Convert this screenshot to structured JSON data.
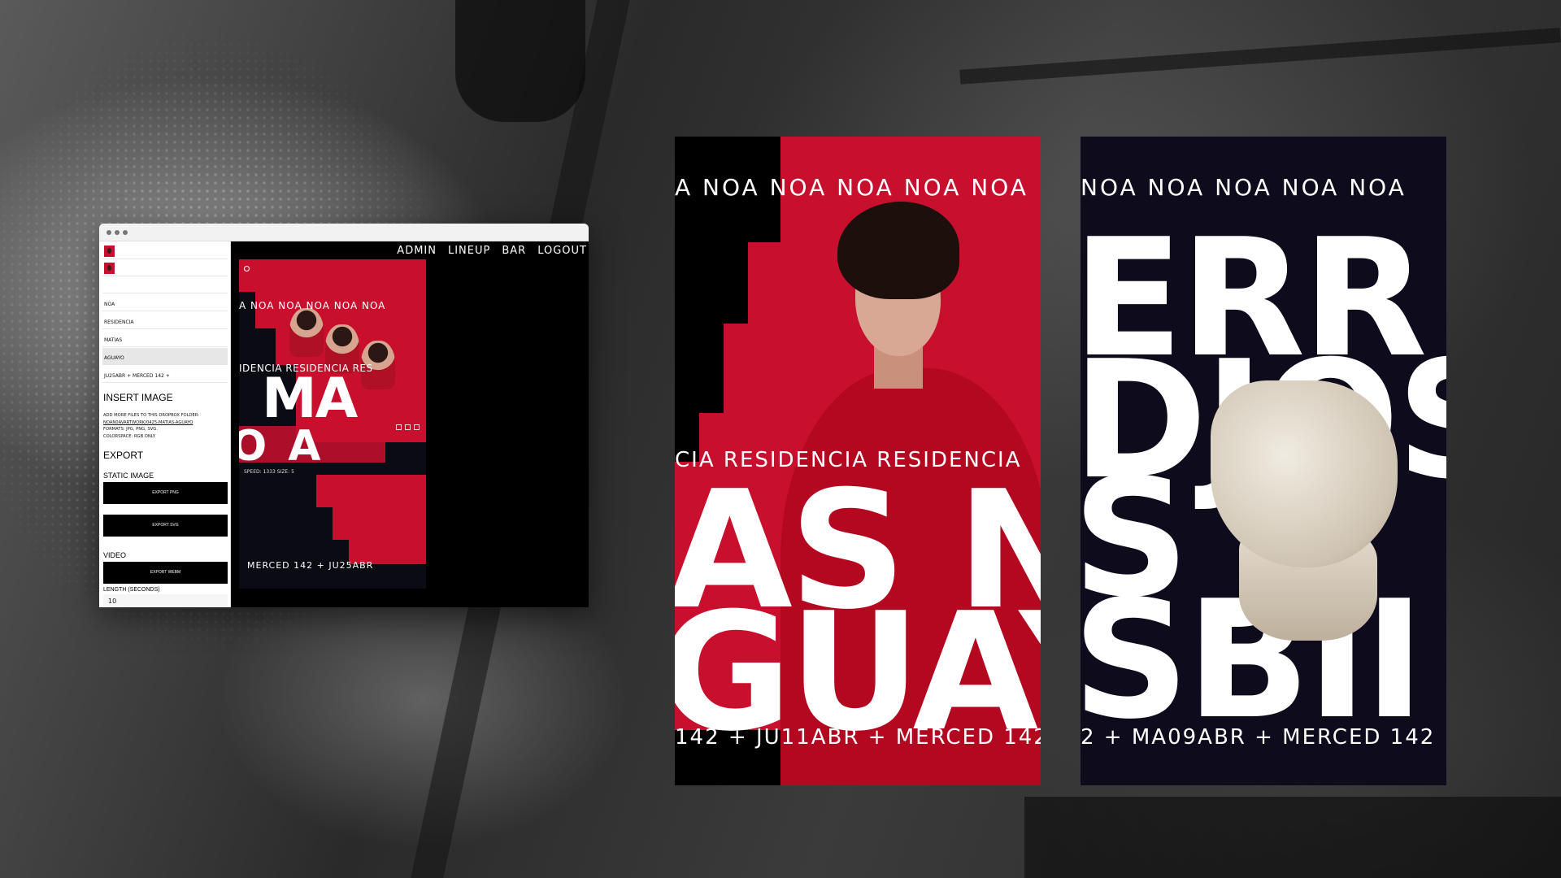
{
  "app": {
    "nav": [
      "ADMIN",
      "LINEUP",
      "BAR",
      "LOGOUT"
    ],
    "fields": [
      "NOA",
      "RESIDENCIA",
      "MATIAS",
      "AGUAYO",
      "JU25ABR + MERCED 142 +"
    ],
    "insert_image": {
      "title": "INSERT IMAGE",
      "note": "ADD MORE FILES TO THIS DROPBOX FOLDER:",
      "folder": "NOAN0AVARTWORK/0425-MATIAS-AGUAYO",
      "formats": "FORMATS: JPG, PNG, SVG.",
      "colorspace": "COLORSPACE: RGB ONLY."
    },
    "export": {
      "title": "EXPORT",
      "static_label": "STATIC IMAGE",
      "png_button": "EXPORT PNG",
      "svg_button": "EXPORT SVG",
      "video_label": "VIDEO",
      "webm_button": "EXPORT WEBM",
      "length_label": "LENGTH (SECONDS)",
      "length_value": "10"
    },
    "preview": {
      "noa_line": "A NOA NOA NOA NOA NOA",
      "res_line": "IDENCIA RESIDENCIA RES",
      "big1": "MA",
      "big2": "O A",
      "speed": "SPEED: 1333      SIZE: 5",
      "bottom": "MERCED 142  +  JU25ABR"
    }
  },
  "posters": [
    {
      "noa_line": "A  NOA  NOA  NOA  NOA  NOA",
      "res_line": "CIA  RESIDENCIA  RESIDENCIA",
      "big1": "AS N",
      "big2": "GUAY",
      "bottom": "142  +  JU11ABR  +  MERCED 142"
    },
    {
      "noa_line": "NOA  NOA  NOA  NOA  NOA",
      "big1": "ERR",
      "big2": "DJOS",
      "big3": "S J",
      "big4": "SBII",
      "bottom": "2  +  MA09ABR  +  MERCED 142"
    }
  ],
  "colors": {
    "accent_red": "#c8102e",
    "navy": "#0e0b1c"
  }
}
